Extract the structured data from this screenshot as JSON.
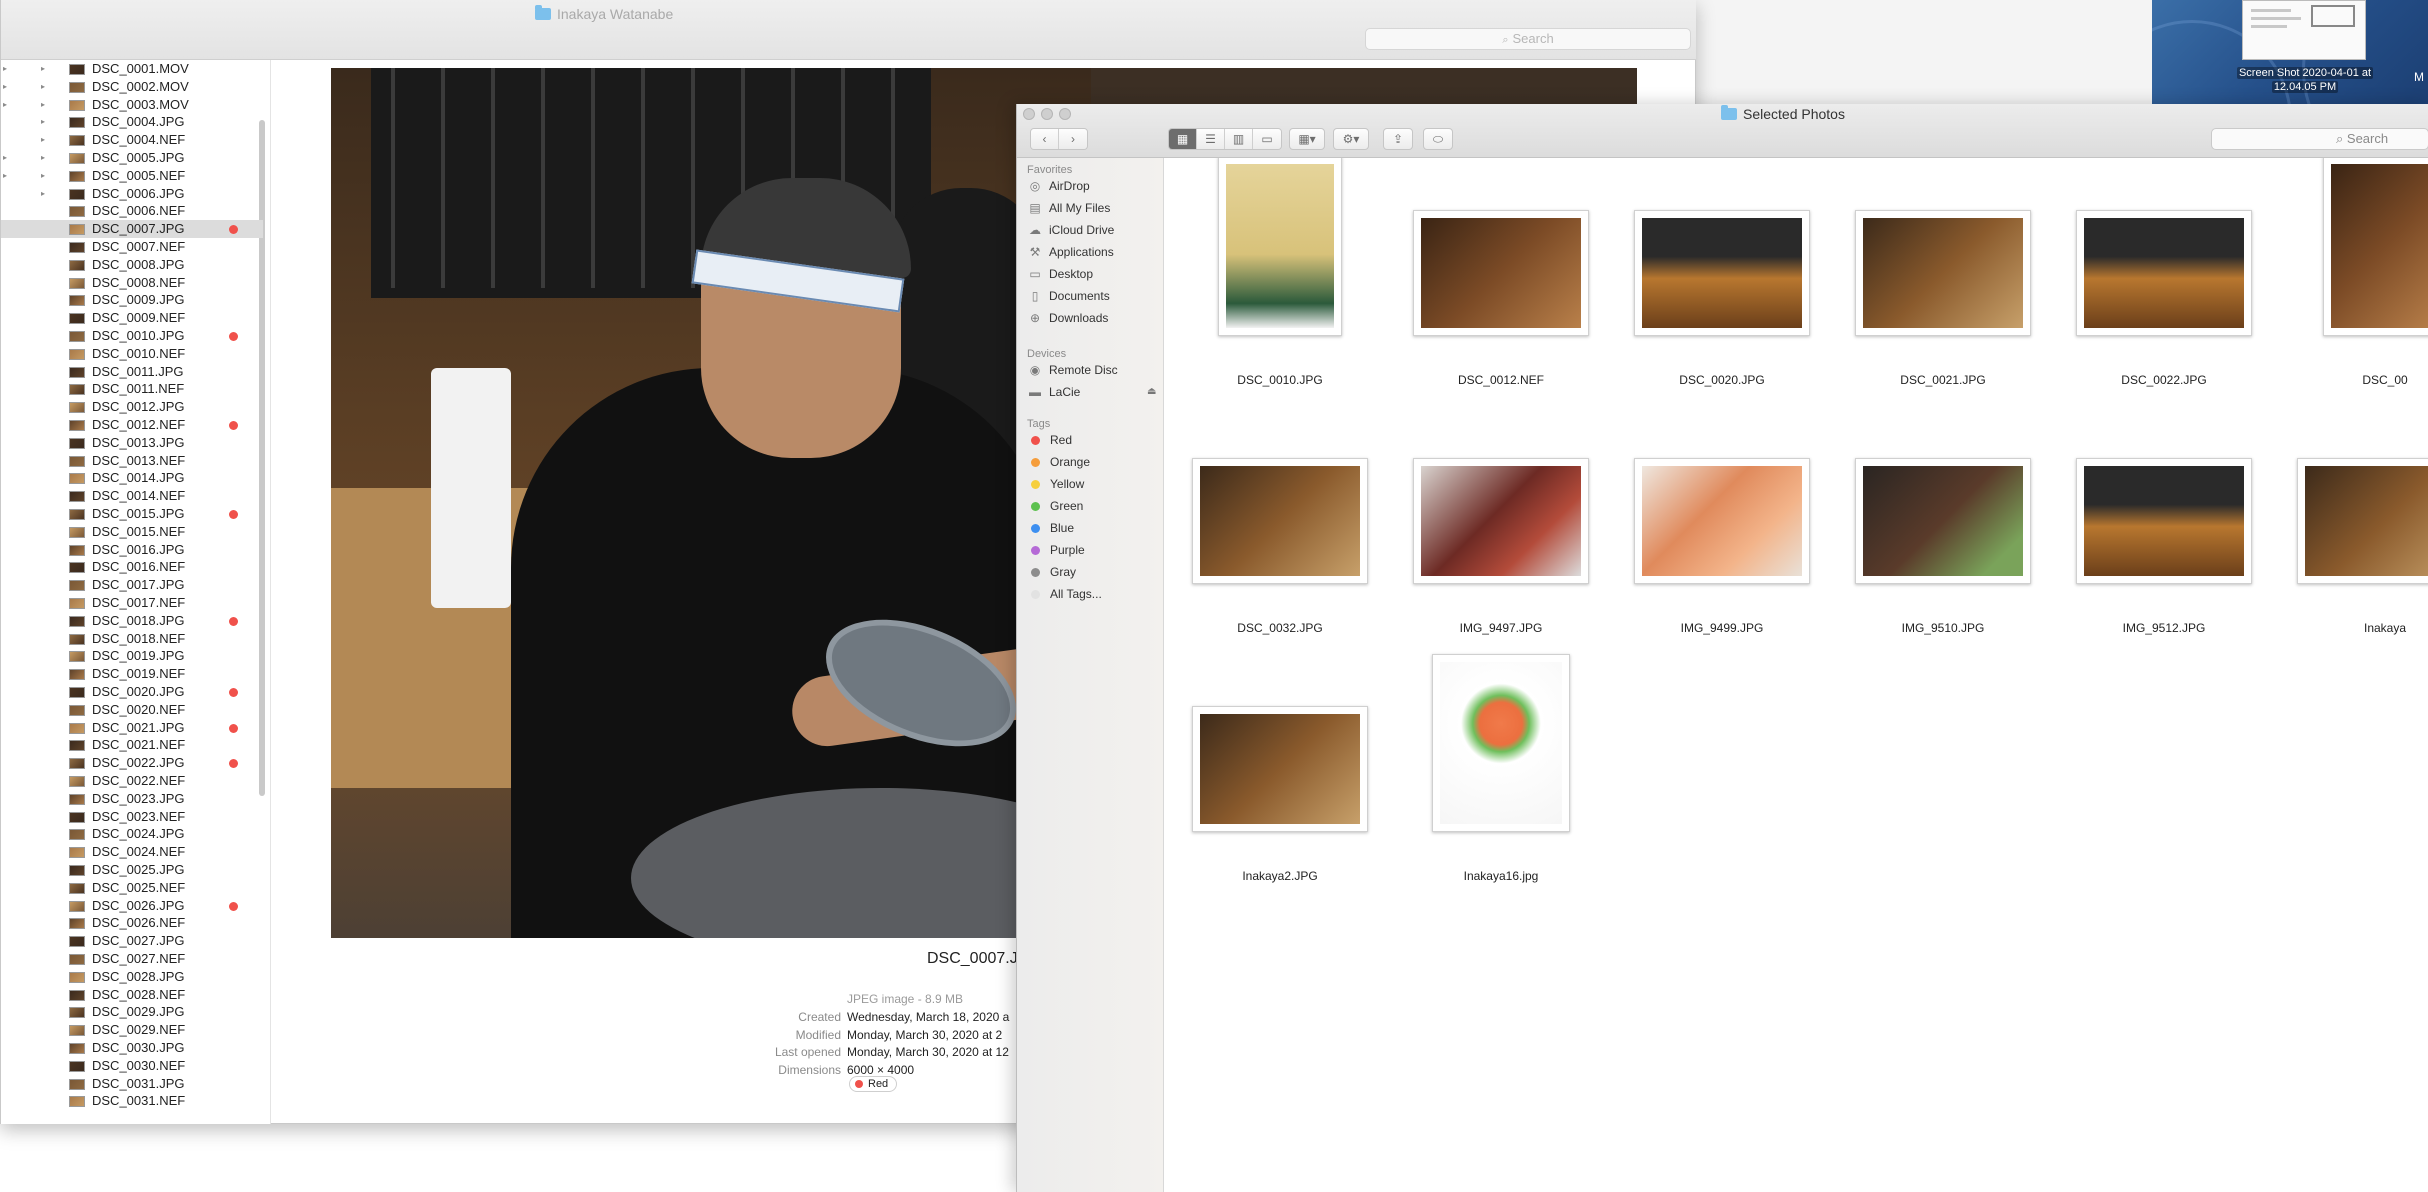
{
  "preview": {
    "title": "Inakaya Watanabe",
    "search_placeholder": "Search",
    "files": [
      {
        "name": "DSC_0001.MOV",
        "tag": false,
        "selected": false
      },
      {
        "name": "DSC_0002.MOV",
        "tag": false,
        "selected": false
      },
      {
        "name": "DSC_0003.MOV",
        "tag": false,
        "selected": false
      },
      {
        "name": "DSC_0004.JPG",
        "tag": false,
        "selected": false
      },
      {
        "name": "DSC_0004.NEF",
        "tag": false,
        "selected": false
      },
      {
        "name": "DSC_0005.JPG",
        "tag": false,
        "selected": false
      },
      {
        "name": "DSC_0005.NEF",
        "tag": false,
        "selected": false
      },
      {
        "name": "DSC_0006.JPG",
        "tag": false,
        "selected": false
      },
      {
        "name": "DSC_0006.NEF",
        "tag": false,
        "selected": false
      },
      {
        "name": "DSC_0007.JPG",
        "tag": true,
        "selected": true
      },
      {
        "name": "DSC_0007.NEF",
        "tag": false,
        "selected": false
      },
      {
        "name": "DSC_0008.JPG",
        "tag": false,
        "selected": false
      },
      {
        "name": "DSC_0008.NEF",
        "tag": false,
        "selected": false
      },
      {
        "name": "DSC_0009.JPG",
        "tag": false,
        "selected": false
      },
      {
        "name": "DSC_0009.NEF",
        "tag": false,
        "selected": false
      },
      {
        "name": "DSC_0010.JPG",
        "tag": true,
        "selected": false
      },
      {
        "name": "DSC_0010.NEF",
        "tag": false,
        "selected": false
      },
      {
        "name": "DSC_0011.JPG",
        "tag": false,
        "selected": false
      },
      {
        "name": "DSC_0011.NEF",
        "tag": false,
        "selected": false
      },
      {
        "name": "DSC_0012.JPG",
        "tag": false,
        "selected": false
      },
      {
        "name": "DSC_0012.NEF",
        "tag": true,
        "selected": false
      },
      {
        "name": "DSC_0013.JPG",
        "tag": false,
        "selected": false
      },
      {
        "name": "DSC_0013.NEF",
        "tag": false,
        "selected": false
      },
      {
        "name": "DSC_0014.JPG",
        "tag": false,
        "selected": false
      },
      {
        "name": "DSC_0014.NEF",
        "tag": false,
        "selected": false
      },
      {
        "name": "DSC_0015.JPG",
        "tag": true,
        "selected": false
      },
      {
        "name": "DSC_0015.NEF",
        "tag": false,
        "selected": false
      },
      {
        "name": "DSC_0016.JPG",
        "tag": false,
        "selected": false
      },
      {
        "name": "DSC_0016.NEF",
        "tag": false,
        "selected": false
      },
      {
        "name": "DSC_0017.JPG",
        "tag": false,
        "selected": false
      },
      {
        "name": "DSC_0017.NEF",
        "tag": false,
        "selected": false
      },
      {
        "name": "DSC_0018.JPG",
        "tag": true,
        "selected": false
      },
      {
        "name": "DSC_0018.NEF",
        "tag": false,
        "selected": false
      },
      {
        "name": "DSC_0019.JPG",
        "tag": false,
        "selected": false
      },
      {
        "name": "DSC_0019.NEF",
        "tag": false,
        "selected": false
      },
      {
        "name": "DSC_0020.JPG",
        "tag": true,
        "selected": false
      },
      {
        "name": "DSC_0020.NEF",
        "tag": false,
        "selected": false
      },
      {
        "name": "DSC_0021.JPG",
        "tag": true,
        "selected": false
      },
      {
        "name": "DSC_0021.NEF",
        "tag": false,
        "selected": false
      },
      {
        "name": "DSC_0022.JPG",
        "tag": true,
        "selected": false
      },
      {
        "name": "DSC_0022.NEF",
        "tag": false,
        "selected": false
      },
      {
        "name": "DSC_0023.JPG",
        "tag": false,
        "selected": false
      },
      {
        "name": "DSC_0023.NEF",
        "tag": false,
        "selected": false
      },
      {
        "name": "DSC_0024.JPG",
        "tag": false,
        "selected": false
      },
      {
        "name": "DSC_0024.NEF",
        "tag": false,
        "selected": false
      },
      {
        "name": "DSC_0025.JPG",
        "tag": false,
        "selected": false
      },
      {
        "name": "DSC_0025.NEF",
        "tag": false,
        "selected": false
      },
      {
        "name": "DSC_0026.JPG",
        "tag": true,
        "selected": false
      },
      {
        "name": "DSC_0026.NEF",
        "tag": false,
        "selected": false
      },
      {
        "name": "DSC_0027.JPG",
        "tag": false,
        "selected": false
      },
      {
        "name": "DSC_0027.NEF",
        "tag": false,
        "selected": false
      },
      {
        "name": "DSC_0028.JPG",
        "tag": false,
        "selected": false
      },
      {
        "name": "DSC_0028.NEF",
        "tag": false,
        "selected": false
      },
      {
        "name": "DSC_0029.JPG",
        "tag": false,
        "selected": false
      },
      {
        "name": "DSC_0029.NEF",
        "tag": false,
        "selected": false
      },
      {
        "name": "DSC_0030.JPG",
        "tag": false,
        "selected": false
      },
      {
        "name": "DSC_0030.NEF",
        "tag": false,
        "selected": false
      },
      {
        "name": "DSC_0031.JPG",
        "tag": false,
        "selected": false
      },
      {
        "name": "DSC_0031.NEF",
        "tag": false,
        "selected": false
      }
    ],
    "info": {
      "filename": "DSC_0007.J",
      "kind": "JPEG image - 8.9 MB",
      "rows": [
        {
          "key": "Created",
          "value": "Wednesday, March 18, 2020 a"
        },
        {
          "key": "Modified",
          "value": "Monday, March 30, 2020 at 2"
        },
        {
          "key": "Last opened",
          "value": "Monday, March 30, 2020 at 12"
        },
        {
          "key": "Dimensions",
          "value": "6000 × 4000"
        }
      ],
      "tag": "Red"
    }
  },
  "desktop": {
    "screenshot_caption_line1": "Screen Shot 2020-04-01 at",
    "screenshot_caption_line2": "12.04.05 PM",
    "edge_label": "M"
  },
  "finder": {
    "title": "Selected Photos",
    "search_placeholder": "Search",
    "sidebar": {
      "favorites_header": "Favorites",
      "favorites": [
        {
          "label": "AirDrop",
          "icon": "airdrop-icon",
          "glyph": "◎"
        },
        {
          "label": "All My Files",
          "icon": "all-files-icon",
          "glyph": "▤"
        },
        {
          "label": "iCloud Drive",
          "icon": "cloud-icon",
          "glyph": "☁"
        },
        {
          "label": "Applications",
          "icon": "applications-icon",
          "glyph": "⚒"
        },
        {
          "label": "Desktop",
          "icon": "desktop-icon",
          "glyph": "▭"
        },
        {
          "label": "Documents",
          "icon": "documents-icon",
          "glyph": "▯"
        },
        {
          "label": "Downloads",
          "icon": "downloads-icon",
          "glyph": "⊕"
        }
      ],
      "devices_header": "Devices",
      "devices": [
        {
          "label": "Remote Disc",
          "icon": "disc-icon",
          "glyph": "◉"
        },
        {
          "label": "LaCie",
          "icon": "drive-icon",
          "glyph": "▬"
        }
      ],
      "tags_header": "Tags",
      "tags": [
        {
          "label": "Red",
          "color": "#f0514b"
        },
        {
          "label": "Orange",
          "color": "#f59d3c"
        },
        {
          "label": "Yellow",
          "color": "#f6cf3e"
        },
        {
          "label": "Green",
          "color": "#5dc14f"
        },
        {
          "label": "Blue",
          "color": "#3d8ff0"
        },
        {
          "label": "Purple",
          "color": "#b56ad6"
        },
        {
          "label": "Gray",
          "color": "#8d8d8d"
        },
        {
          "label": "All Tags...",
          "color": "#e2e2e2"
        }
      ]
    },
    "items": [
      {
        "name": "DSC_0010.JPG",
        "orient": "portrait",
        "tone": "cake"
      },
      {
        "name": "DSC_0012.NEF",
        "orient": "landscape",
        "tone": "wood"
      },
      {
        "name": "DSC_0020.JPG",
        "orient": "landscape",
        "tone": "bar"
      },
      {
        "name": "DSC_0021.JPG",
        "orient": "landscape",
        "tone": "kitchen"
      },
      {
        "name": "DSC_0022.JPG",
        "orient": "landscape",
        "tone": "bar"
      },
      {
        "name": "DSC_00",
        "orient": "portrait",
        "tone": "wood"
      },
      {
        "name": "DSC_0032.JPG",
        "orient": "landscape",
        "tone": "kitchen"
      },
      {
        "name": "IMG_9497.JPG",
        "orient": "landscape",
        "tone": "seafood"
      },
      {
        "name": "IMG_9499.JPG",
        "orient": "landscape",
        "tone": "shrimp"
      },
      {
        "name": "IMG_9510.JPG",
        "orient": "landscape",
        "tone": "dark"
      },
      {
        "name": "IMG_9512.JPG",
        "orient": "landscape",
        "tone": "bar"
      },
      {
        "name": "Inakaya",
        "orient": "landscape",
        "tone": "kitchen"
      },
      {
        "name": "Inakaya2.JPG",
        "orient": "landscape",
        "tone": "kitchen"
      },
      {
        "name": "Inakaya16.jpg",
        "orient": "portrait",
        "tone": "bowl"
      }
    ]
  }
}
